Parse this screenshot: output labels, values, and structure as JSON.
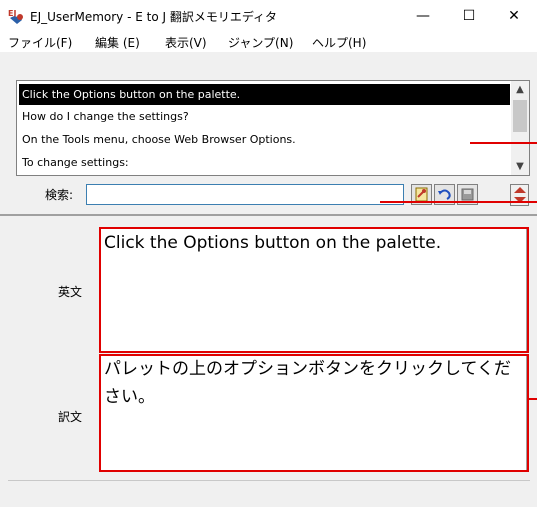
{
  "window": {
    "title": "EJ_UserMemory - E to J 翻訳メモリエディタ",
    "minimize_glyph": "—",
    "maximize_glyph": "☐",
    "close_glyph": "✕",
    "icon": "app-ej-icon"
  },
  "menubar": {
    "items": [
      {
        "label": "ファイル(F)"
      },
      {
        "label": "編集 (E)"
      },
      {
        "label": "表示(V)"
      },
      {
        "label": "ジャンプ(N)"
      },
      {
        "label": "ヘルプ(H)"
      }
    ]
  },
  "list": {
    "rows": [
      {
        "text": "Click the Options button on the palette.",
        "selected": true
      },
      {
        "text": "How do I change the settings?",
        "selected": false
      },
      {
        "text": "On the Tools menu, choose Web Browser Options.",
        "selected": false
      },
      {
        "text": "To change settings:",
        "selected": false
      }
    ]
  },
  "search": {
    "label": "検索:",
    "value": ""
  },
  "toolbar": {
    "icons": [
      "find-icon",
      "undo-icon",
      "save-icon",
      "spin-up-down-icon"
    ]
  },
  "editor": {
    "english_label": "英文",
    "english_text": "Click the Options button on the palette.",
    "japanese_label": "訳文",
    "japanese_text": "パレットの上のオプションボタンをクリックしてください。"
  },
  "colors": {
    "annotation": "#e00000",
    "selection": "#000000",
    "accent": "#3c7fb1"
  }
}
